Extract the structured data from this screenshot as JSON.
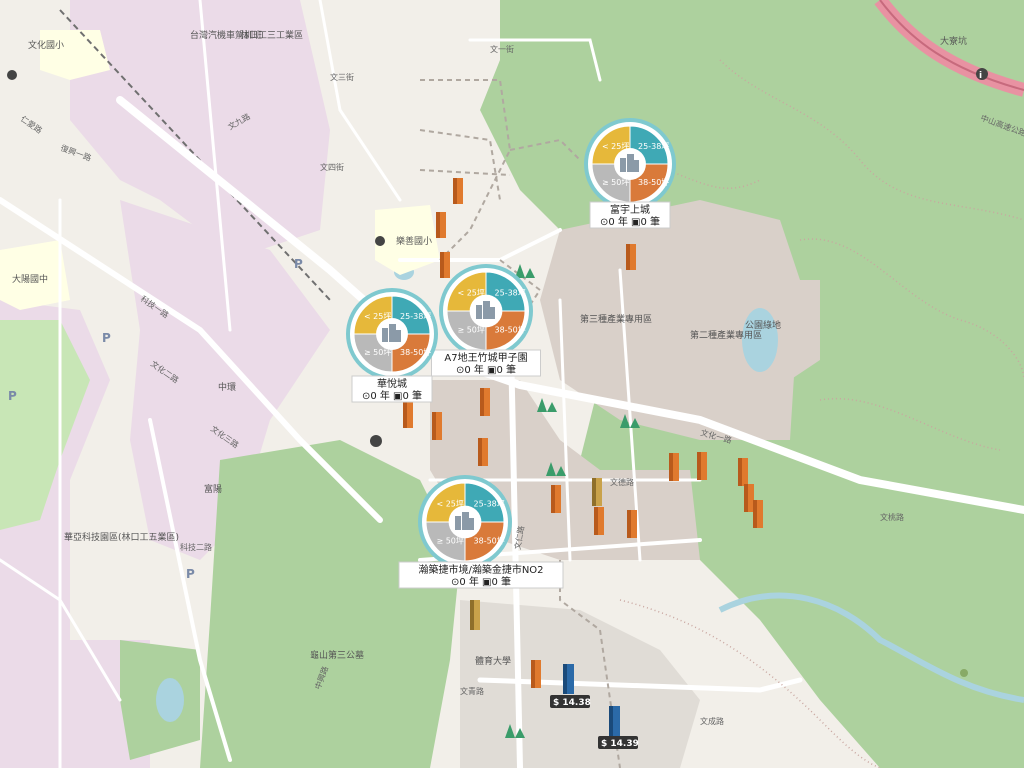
{
  "colors": {
    "seg_small": "#e6b83a",
    "seg_mid": "#3fa9b5",
    "seg_large": "#d97a3a",
    "seg_xl": "#b9b9b9",
    "green": "#add19e",
    "industrial": "#ebdbe8",
    "urban": "#d9d0c9",
    "water": "#aad3df",
    "school": "#ffffe5",
    "motorway": "#e892a2"
  },
  "clusters": [
    {
      "name": "富宇上城",
      "stats": "⊙0 年 ▣0 筆",
      "labels": {
        "small": "< 25坪",
        "mid": "25-38坪",
        "large": "38-50坪",
        "xl": "≥ 50坪"
      }
    },
    {
      "name": "A7地王竹城甲子園",
      "stats": "⊙0 年 ▣0 筆",
      "labels": {
        "small": "< 25坪",
        "mid": "25-38坪",
        "large": "38-50坪",
        "xl": "≥ 50坪"
      }
    },
    {
      "name": "華悅城",
      "stats": "⊙0 年 ▣0 筆",
      "labels": {
        "small": "< 25坪",
        "mid": "25-38坪",
        "large": "38-50坪",
        "xl": "≥ 50坪"
      }
    },
    {
      "name": "瀚築捷市境/瀚築金捷市NO2",
      "stats": "⊙0 年 ▣0 筆",
      "labels": {
        "small": "< 25坪",
        "mid": "25-38坪",
        "large": "38-50坪",
        "xl": "≥ 50坪"
      }
    }
  ],
  "prices": [
    "$ 14.38",
    "$ 14.39"
  ],
  "places": {
    "motor_school": "台灣汽機車駕訓班",
    "industrial_zone": "林口工三工業區",
    "wenhua_school": "文化國小",
    "dapin_school": "大陽國中",
    "leshan_school": "樂善國小",
    "daguan": "大寮坑",
    "sports_univ": "體育大學",
    "guishan": "龜山第三公墓",
    "huaya": "華亞科技園區(林口工五業區)",
    "zhonghuan": "中環",
    "fuyuan": "富陽",
    "waterpark": "公園綠地",
    "third_zone": "第三種產業專用區",
    "second_zone": "第二種產業專用區",
    "tech_park": "科技二路",
    "sunshan_hwy": "中山高速公路"
  },
  "roads": [
    "文化二路",
    "文化一路",
    "文化三路",
    "文青路",
    "文桃路",
    "文德路",
    "文成路",
    "科技一路",
    "科技二路",
    "復興一路",
    "仁愛路",
    "中興路",
    "文仁路",
    "文三街",
    "文四街",
    "文九路",
    "文一街"
  ]
}
